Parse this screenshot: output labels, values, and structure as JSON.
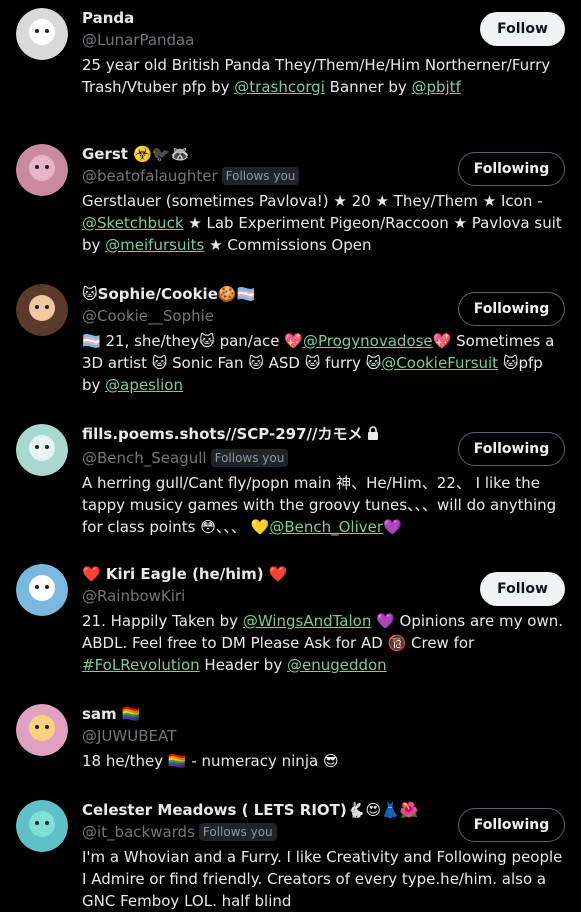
{
  "accounts": [
    {
      "name": "Panda",
      "handle": "@LunarPandaa",
      "follows_you": "",
      "button": "Follow",
      "avatar_color": "#d9d9d9",
      "bio": [
        {
          "t": "25 year old British Panda They/Them/He/Him Northerner/Furry Trash/Vtuber pfp by "
        },
        {
          "t": "@trashcorgi",
          "link": true
        },
        {
          "t": " Banner by "
        },
        {
          "t": "@pbjtf",
          "link": true
        }
      ]
    },
    {
      "name": "Gerst ☣️🐦‍⬛🦝",
      "handle": "@beatofalaughter",
      "follows_you": "Follows you",
      "button": "Following",
      "avatar_color": "#c98aa0",
      "bio": [
        {
          "t": "Gerstlauer (sometimes Pavlova!) ★ 20 ★ They/Them ★ Icon - "
        },
        {
          "t": "@Sketchbuck",
          "link": true
        },
        {
          "t": " ★ Lab Experiment Pigeon/Raccoon ★ Pavlova suit by "
        },
        {
          "t": "@meifursuits",
          "link": true
        },
        {
          "t": " ★ Commissions Open"
        }
      ]
    },
    {
      "name": "🐱Sophie/Cookie🍪🏳️‍⚧️",
      "handle": "@Cookie__Sophie",
      "follows_you": "",
      "button": "Following",
      "avatar_color": "#5a3a2a",
      "bio": [
        {
          "t": "🏳️‍⚧️ 21, she/they🐱 pan/ace 💖"
        },
        {
          "t": "@Progynovadose",
          "link": true
        },
        {
          "t": "💖 Sometimes a 3D artist 🐱 Sonic Fan 🐱 ASD 🐱 furry 🐱"
        },
        {
          "t": "@CookieFursuit",
          "link": true
        },
        {
          "t": " 🐱pfp by "
        },
        {
          "t": "@apeslion",
          "link": true
        }
      ]
    },
    {
      "name": "fills.poems.shots//SCP-297//カモメ",
      "handle": "@Bench_Seagull",
      "follows_you": "Follows you",
      "button": "Following",
      "avatar_color": "#a8d8d0",
      "bio": [
        {
          "t": "A herring gull/Cant fly/popn main 神、He/Him、22、 I like the tappy musicy games with the groovy tunes、、、will do anything for class points 😳、、、 💛"
        },
        {
          "t": "@Bench_Oliver",
          "link": true
        },
        {
          "t": "💜"
        }
      ]
    },
    {
      "name": "❤️ Kiri Eagle (he/him) ❤️",
      "handle": "@RainbowKiri",
      "follows_you": "",
      "button": "Follow",
      "avatar_color": "#7ab8e0",
      "bio": [
        {
          "t": "21. Happily Taken by "
        },
        {
          "t": "@WingsAndTalon",
          "link": true
        },
        {
          "t": " 💜 Opinions are my own. ABDL. Feel free to DM Please Ask for AD 🔞 Crew for "
        },
        {
          "t": "#FoLRevolution",
          "link": true
        },
        {
          "t": " Header by "
        },
        {
          "t": "@enugeddon",
          "link": true
        }
      ]
    },
    {
      "name": "sam 🏳️‍🌈",
      "handle": "@JUWUBEAT",
      "follows_you": "",
      "button": "",
      "avatar_color": "#e0a0c0",
      "bio": [
        {
          "t": "18 he/they 🏳️‍🌈 - numeracy ninja 😎"
        }
      ]
    },
    {
      "name": "Celester Meadows ( LETS RIOT)🐇😍👗🌺",
      "handle": "@it_backwards",
      "follows_you": "Follows you",
      "button": "Following",
      "avatar_color": "#5fc0c8",
      "bio": [
        {
          "t": "I'm a Whovian and a Furry. I like Creativity and Following people I Admire or find friendly. Creators of every type.he/him. also a GNC Femboy LOL. half blind"
        }
      ]
    }
  ]
}
